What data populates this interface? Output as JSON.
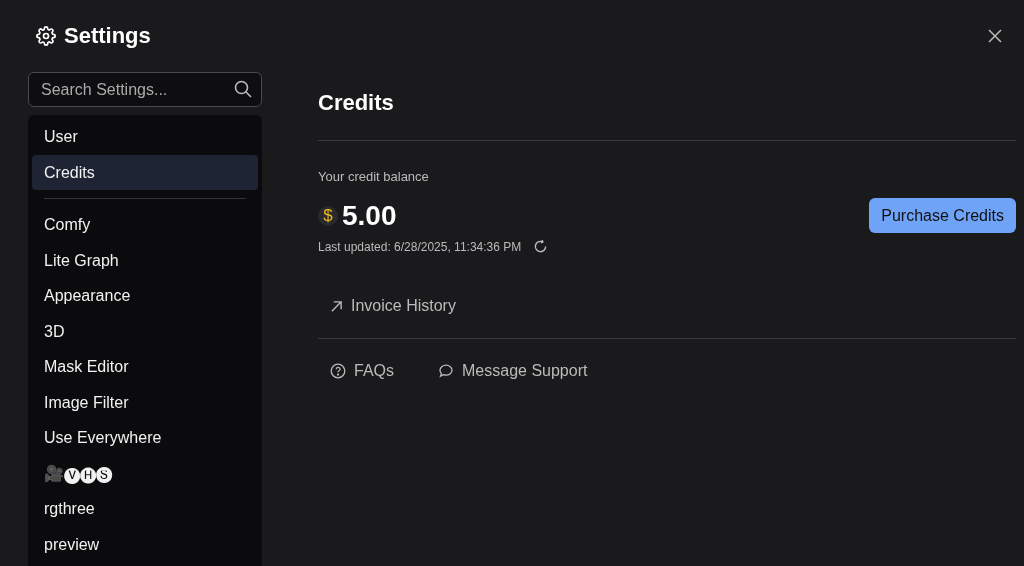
{
  "window": {
    "title": "Settings"
  },
  "search": {
    "placeholder": "Search Settings..."
  },
  "sidebar": {
    "groups": [
      [
        {
          "label": "User",
          "selected": false
        },
        {
          "label": "Credits",
          "selected": true
        }
      ],
      [
        {
          "label": "Comfy",
          "selected": false
        },
        {
          "label": "Lite Graph",
          "selected": false
        },
        {
          "label": "Appearance",
          "selected": false
        },
        {
          "label": "3D",
          "selected": false
        },
        {
          "label": "Mask Editor",
          "selected": false
        },
        {
          "label": "Image Filter",
          "selected": false
        },
        {
          "label": "Use Everywhere",
          "selected": false
        },
        {
          "label": "🎥🅥🅗🅢",
          "selected": false
        },
        {
          "label": "rgthree",
          "selected": false
        },
        {
          "label": "preview",
          "selected": false
        }
      ]
    ]
  },
  "content": {
    "heading": "Credits",
    "balance_label": "Your credit balance",
    "currency": "$",
    "balance": "5.00",
    "purchase_button": "Purchase Credits",
    "last_updated": "Last updated: 6/28/2025, 11:34:36 PM",
    "invoice_link": "Invoice History",
    "footer_links": [
      {
        "kind": "faq",
        "label": "FAQs"
      },
      {
        "kind": "support",
        "label": "Message Support"
      }
    ]
  }
}
